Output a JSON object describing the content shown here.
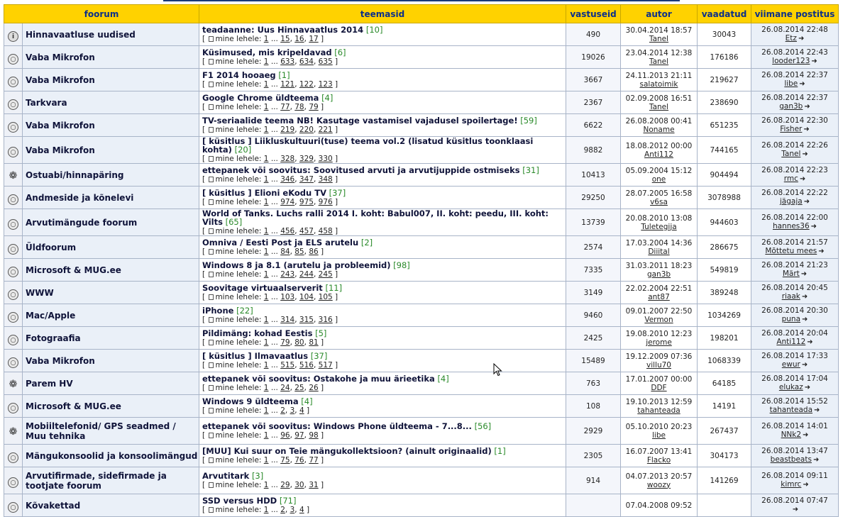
{
  "headers": {
    "forum": "foorum",
    "topics": "teemasid",
    "replies": "vastuseid",
    "author": "autor",
    "views": "vaadatud",
    "last_post": "viimane postitus"
  },
  "pages_label": "mine lehele:",
  "rows": [
    {
      "icon": "info",
      "forum": "Hinnavaatluse uudised",
      "title": "teadaanne: Uus Hinnavaatlus 2014",
      "count": "[10]",
      "pages": [
        "1",
        "15",
        "16",
        "17"
      ],
      "replies": "490",
      "auth_date": "30.04.2014 18:57",
      "auth_user": "Tanel",
      "views": "30043",
      "last_date": "26.08.2014 22:48",
      "last_user": "Etz"
    },
    {
      "icon": "topic",
      "forum": "Vaba Mikrofon",
      "title": "Küsimused, mis kripeldavad",
      "count": "[6]",
      "pages": [
        "1",
        "633",
        "634",
        "635"
      ],
      "replies": "19026",
      "auth_date": "23.04.2014 12:38",
      "auth_user": "Tanel",
      "views": "176186",
      "last_date": "26.08.2014 22:43",
      "last_user": "looder123"
    },
    {
      "icon": "topic",
      "forum": "Vaba Mikrofon",
      "title": "F1 2014 hooaeg",
      "count": "[1]",
      "pages": [
        "1",
        "121",
        "122",
        "123"
      ],
      "replies": "3667",
      "auth_date": "24.11.2013 21:11",
      "auth_user": "salatoimik",
      "views": "219627",
      "last_date": "26.08.2014 22:37",
      "last_user": "libe"
    },
    {
      "icon": "topic",
      "forum": "Tarkvara",
      "title": "Google Chrome üldteema",
      "count": "[4]",
      "pages": [
        "1",
        "77",
        "78",
        "79"
      ],
      "replies": "2367",
      "auth_date": "02.09.2008 16:51",
      "auth_user": "Tanel",
      "views": "238690",
      "last_date": "26.08.2014 22:37",
      "last_user": "gan3b"
    },
    {
      "icon": "topic",
      "forum": "Vaba Mikrofon",
      "title": "TV-seriaalide teema NB! Kasutage vastamisel vajadusel spoilertage!",
      "count": "[59]",
      "pages": [
        "1",
        "219",
        "220",
        "221"
      ],
      "replies": "6622",
      "auth_date": "26.08.2008 00:41",
      "auth_user": "Noname",
      "views": "651235",
      "last_date": "26.08.2014 22:30",
      "last_user": "Fisher"
    },
    {
      "icon": "topic",
      "tall": true,
      "forum": "Vaba Mikrofon",
      "title": "[ küsitlus ] Liikluskultuuri(tuse) teema vol.2 (lisatud küsitlus toonklaasi kohta)",
      "count": "[20]",
      "pages": [
        "1",
        "328",
        "329",
        "330"
      ],
      "replies": "9882",
      "auth_date": "18.08.2012 00:00",
      "auth_user": "Anti112",
      "views": "744165",
      "last_date": "26.08.2014 22:26",
      "last_user": "Tanel"
    },
    {
      "icon": "puzzle",
      "forum": "Ostuabi/hinnapäring",
      "title": "ettepanek või soovitus: Soovitused arvuti ja arvutijuppide ostmiseks",
      "count": "[31]",
      "pages": [
        "1",
        "346",
        "347",
        "348"
      ],
      "replies": "10413",
      "auth_date": "05.09.2004 15:12",
      "auth_user": "one",
      "views": "904494",
      "last_date": "26.08.2014 22:23",
      "last_user": "rmc"
    },
    {
      "icon": "topic",
      "forum": "Andmeside ja kõnelevi",
      "title": "[ küsitlus ] Elioni eKodu TV",
      "count": "[37]",
      "pages": [
        "1",
        "974",
        "975",
        "976"
      ],
      "replies": "29250",
      "auth_date": "28.07.2005 16:58",
      "auth_user": "v6sa",
      "views": "3078988",
      "last_date": "26.08.2014 22:22",
      "last_user": "jägaja"
    },
    {
      "icon": "topic",
      "tall": true,
      "forum": "Arvutimängude foorum",
      "title": "World of Tanks. Luchs ralli 2014 I. koht: Babul007, II. koht: peedu, III. koht: Vilts",
      "count": "[65]",
      "pages": [
        "1",
        "456",
        "457",
        "458"
      ],
      "replies": "13739",
      "auth_date": "20.08.2010 13:08",
      "auth_user": "Tuletegija",
      "views": "944603",
      "last_date": "26.08.2014 22:00",
      "last_user": "hannes36"
    },
    {
      "icon": "topic",
      "forum": "Üldfoorum",
      "title": "Omniva / Eesti Post ja ELS arutelu",
      "count": "[2]",
      "pages": [
        "1",
        "84",
        "85",
        "86"
      ],
      "replies": "2574",
      "auth_date": "17.03.2004 14:36",
      "auth_user": "Diiital",
      "views": "286675",
      "last_date": "26.08.2014 21:57",
      "last_user": "Mõttetu mees"
    },
    {
      "icon": "topic",
      "forum": "Microsoft & MUG.ee",
      "title": "Windows 8 ja 8.1 (arutelu ja probleemid)",
      "count": "[98]",
      "pages": [
        "1",
        "243",
        "244",
        "245"
      ],
      "replies": "7335",
      "auth_date": "31.03.2011 18:23",
      "auth_user": "gan3b",
      "views": "549819",
      "last_date": "26.08.2014 21:23",
      "last_user": "Märt"
    },
    {
      "icon": "topic",
      "forum": "WWW",
      "title": "Soovitage virtuaalserverit",
      "count": "[11]",
      "pages": [
        "1",
        "103",
        "104",
        "105"
      ],
      "replies": "3149",
      "auth_date": "22.02.2004 22:51",
      "auth_user": "ant87",
      "views": "389248",
      "last_date": "26.08.2014 20:45",
      "last_user": "riaak"
    },
    {
      "icon": "topic",
      "forum": "Mac/Apple",
      "title": "iPhone",
      "count": "[22]",
      "pages": [
        "1",
        "314",
        "315",
        "316"
      ],
      "replies": "9460",
      "auth_date": "09.01.2007 22:50",
      "auth_user": "Vermon",
      "views": "1034269",
      "last_date": "26.08.2014 20:30",
      "last_user": "puna"
    },
    {
      "icon": "topic",
      "forum": "Fotograafia",
      "title": "Pildimäng: kohad Eestis",
      "count": "[5]",
      "pages": [
        "1",
        "79",
        "80",
        "81"
      ],
      "replies": "2425",
      "auth_date": "19.08.2010 12:23",
      "auth_user": "jerome",
      "views": "198201",
      "last_date": "26.08.2014 20:04",
      "last_user": "Anti112"
    },
    {
      "icon": "topic",
      "forum": "Vaba Mikrofon",
      "title": "[ küsitlus ] Ilmavaatlus",
      "count": "[37]",
      "pages": [
        "1",
        "515",
        "516",
        "517"
      ],
      "replies": "15489",
      "auth_date": "19.12.2009 07:36",
      "auth_user": "villu70",
      "views": "1068339",
      "last_date": "26.08.2014 17:33",
      "last_user": "ewur"
    },
    {
      "icon": "puzzle",
      "forum": "Parem HV",
      "title": "ettepanek või soovitus: Ostakohe ja muu ärieetika",
      "count": "[4]",
      "pages": [
        "1",
        "24",
        "25",
        "26"
      ],
      "replies": "763",
      "auth_date": "17.01.2007 00:00",
      "auth_user": "DDF",
      "views": "64185",
      "last_date": "26.08.2014 17:04",
      "last_user": "elukaz"
    },
    {
      "icon": "topic",
      "forum": "Microsoft & MUG.ee",
      "title": "Windows 9 üldteema",
      "count": "[4]",
      "pages": [
        "1",
        "2",
        "3",
        "4"
      ],
      "replies": "108",
      "auth_date": "19.10.2013 12:59",
      "auth_user": "tahanteada",
      "views": "14191",
      "last_date": "26.08.2014 15:52",
      "last_user": "tahanteada"
    },
    {
      "icon": "puzzle",
      "tall": true,
      "forum": "Mobiiltelefonid/ GPS seadmed / Muu tehnika",
      "title": "ettepanek või soovitus: Windows Phone üldteema - 7...8...",
      "count": "[56]",
      "pages": [
        "1",
        "96",
        "97",
        "98"
      ],
      "replies": "2929",
      "auth_date": "05.10.2010 20:23",
      "auth_user": "libe",
      "views": "267437",
      "last_date": "26.08.2014 14:01",
      "last_user": "NNk2"
    },
    {
      "icon": "topic",
      "forum": "Mängukonsoolid ja konsoolimängud",
      "title": "[MUU] Kui suur on Teie mängukollektsioon? (ainult originaalid)",
      "count": "[1]",
      "pages": [
        "1",
        "75",
        "76",
        "77"
      ],
      "replies": "2305",
      "auth_date": "16.07.2007 13:41",
      "auth_user": "Flacko",
      "views": "304173",
      "last_date": "26.08.2014 13:47",
      "last_user": "beastbeats"
    },
    {
      "icon": "topic",
      "tall": true,
      "forum": "Arvutifirmade, sidefirmade ja tootjate foorum",
      "title": "Arvutitark",
      "count": "[3]",
      "pages": [
        "1",
        "29",
        "30",
        "31"
      ],
      "replies": "914",
      "auth_date": "04.07.2013 20:57",
      "auth_user": "woozy",
      "views": "141269",
      "last_date": "26.08.2014 09:11",
      "last_user": "kimrc"
    },
    {
      "icon": "topic",
      "forum": "Kõvakettad",
      "title": "SSD versus HDD",
      "count": "[71]",
      "pages": [
        "1",
        "2",
        "3",
        "4"
      ],
      "replies": "",
      "auth_date": "07.04.2008 09:52",
      "auth_user": "",
      "views": "",
      "last_date": "26.08.2014 07:47",
      "last_user": ""
    }
  ]
}
